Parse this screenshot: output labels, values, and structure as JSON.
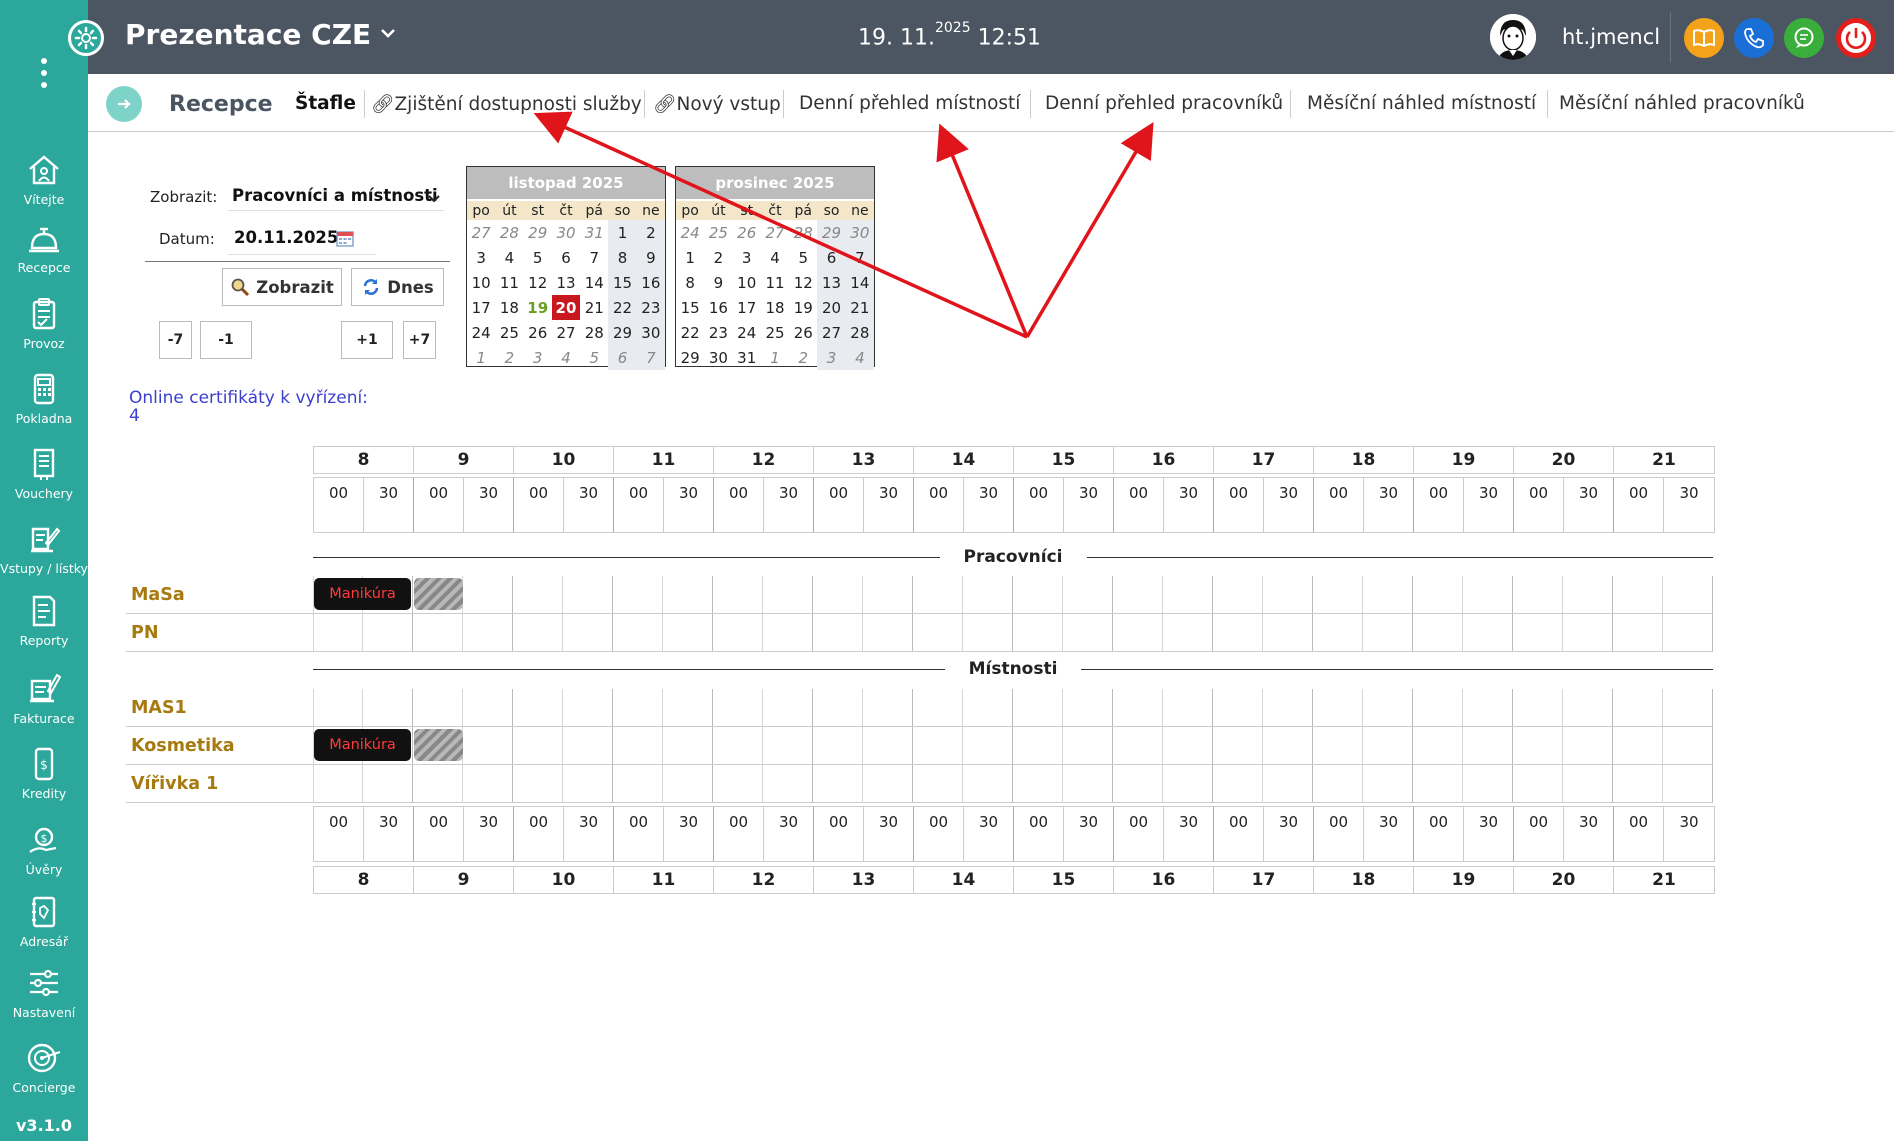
{
  "app": {
    "title": "Prezentace CZE",
    "date": "19. 11.",
    "year": "2025",
    "time": "12:51",
    "user": "ht.jmencl",
    "version": "v3.1.0"
  },
  "sidebar": {
    "items": [
      {
        "label": "Vítejte",
        "icon": "home-icon"
      },
      {
        "label": "Recepce",
        "icon": "reception-bell-icon"
      },
      {
        "label": "Provoz",
        "icon": "clipboard-icon"
      },
      {
        "label": "Pokladna",
        "icon": "cash-register-icon"
      },
      {
        "label": "Vouchery",
        "icon": "voucher-icon"
      },
      {
        "label": "Vstupy / lístky",
        "icon": "ticket-icon"
      },
      {
        "label": "Reporty",
        "icon": "report-icon"
      },
      {
        "label": "Fakturace",
        "icon": "invoice-icon"
      },
      {
        "label": "Kredity",
        "icon": "credit-icon"
      },
      {
        "label": "Úvěry",
        "icon": "loan-icon"
      },
      {
        "label": "Adresář",
        "icon": "address-book-icon"
      },
      {
        "label": "Nastavení",
        "icon": "settings-sliders-icon"
      },
      {
        "label": "Concierge",
        "icon": "concierge-icon"
      }
    ]
  },
  "tabs": {
    "section": "Recepce",
    "items": [
      "Štafle",
      "Zjištění dostupnosti služby",
      "Nový vstup",
      "Denní přehled místností",
      "Denní přehled pracovníků",
      "Měsíční náhled místností",
      "Měsíční náhled pracovníků"
    ]
  },
  "controls": {
    "show_label": "Zobrazit:",
    "show_value": "Pracovníci a místnosti",
    "date_label": "Datum:",
    "date_value": "20.11.2025",
    "show_button": "Zobrazit",
    "today_button": "Dnes",
    "minus7": "-7",
    "minus1": "-1",
    "plus1": "+1",
    "plus7": "+7"
  },
  "calendars": [
    {
      "title": "listopad 2025",
      "weeks": [
        [
          "27",
          "28",
          "29",
          "30",
          "31",
          "1",
          "2"
        ],
        [
          "3",
          "4",
          "5",
          "6",
          "7",
          "8",
          "9"
        ],
        [
          "10",
          "11",
          "12",
          "13",
          "14",
          "15",
          "16"
        ],
        [
          "17",
          "18",
          "19",
          "20",
          "21",
          "22",
          "23"
        ],
        [
          "24",
          "25",
          "26",
          "27",
          "28",
          "29",
          "30"
        ],
        [
          "1",
          "2",
          "3",
          "4",
          "5",
          "6",
          "7"
        ]
      ],
      "today": "19",
      "selected": "20"
    },
    {
      "title": "prosinec 2025",
      "weeks": [
        [
          "24",
          "25",
          "26",
          "27",
          "28",
          "29",
          "30"
        ],
        [
          "1",
          "2",
          "3",
          "4",
          "5",
          "6",
          "7"
        ],
        [
          "8",
          "9",
          "10",
          "11",
          "12",
          "13",
          "14"
        ],
        [
          "15",
          "16",
          "17",
          "18",
          "19",
          "20",
          "21"
        ],
        [
          "22",
          "23",
          "24",
          "25",
          "26",
          "27",
          "28"
        ],
        [
          "29",
          "30",
          "31",
          "1",
          "2",
          "3",
          "4"
        ]
      ]
    }
  ],
  "weekdays": [
    "po",
    "út",
    "st",
    "čt",
    "pá",
    "so",
    "ne"
  ],
  "online": {
    "label": "Online certifikáty k vyřízení:",
    "count": "4"
  },
  "schedule": {
    "hours": [
      "8",
      "9",
      "10",
      "11",
      "12",
      "13",
      "14",
      "15",
      "16",
      "17",
      "18",
      "19",
      "20",
      "21"
    ],
    "minutes": [
      "00",
      "30"
    ],
    "sections": [
      {
        "title": "Pracovníci",
        "rows": [
          {
            "name": "MaSa",
            "appointment": "Manikúra"
          },
          {
            "name": "PN",
            "appointment": null
          }
        ]
      },
      {
        "title": "Místnosti",
        "rows": [
          {
            "name": "MAS1",
            "appointment": null
          },
          {
            "name": "Kosmetika",
            "appointment": "Manikúra"
          },
          {
            "name": "Vířivka 1",
            "appointment": null
          }
        ]
      }
    ]
  },
  "colors": {
    "sidebar": "#2ba89b",
    "topbar": "#4c5562",
    "accent_red": "#c8181e",
    "name_gold": "#a67a0e",
    "link_blue": "#3b3fcf",
    "arrow": "#e0141b"
  }
}
